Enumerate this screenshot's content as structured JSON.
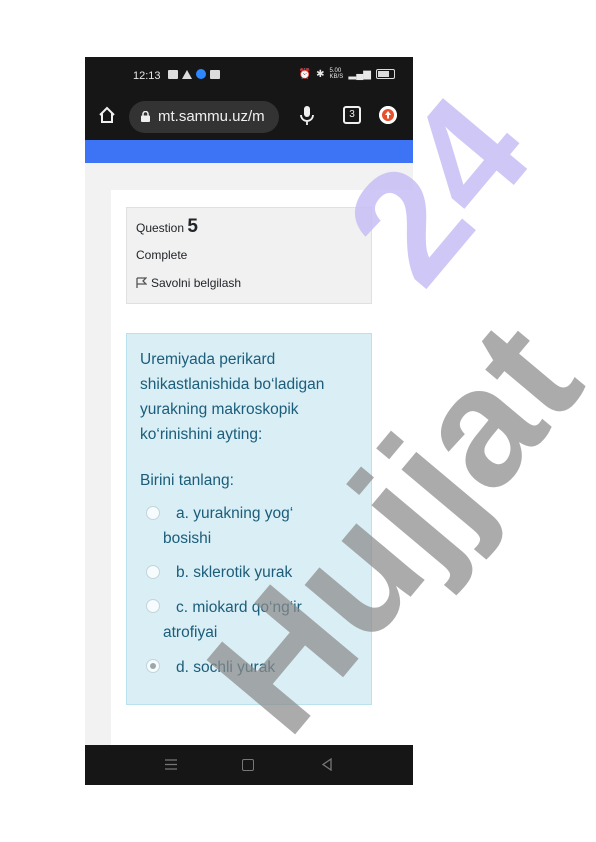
{
  "status_bar": {
    "time": "12:13",
    "net_speed": "5.00 KB/S"
  },
  "browser": {
    "url": "mt.sammu.uz/m",
    "tab_count": "3"
  },
  "question_info": {
    "label": "Question",
    "number": "5",
    "state": "Complete",
    "flag_label": "Savolni belgilash"
  },
  "question": {
    "text": "Uremiyada perikard shikastlanishida bo‘ladigan yurakning makroskopik ko‘rinishini ayting:",
    "choose_label": "Birini tanlang:",
    "options": [
      {
        "line1": "a. yurakning yog‘",
        "line2": "bosishi",
        "selected": false
      },
      {
        "line1": "b. sklerotik yurak",
        "line2": "",
        "selected": false
      },
      {
        "line1": "c. miokard qo‘ng‘ir",
        "line2": "atrofiyai",
        "selected": false
      },
      {
        "line1": "d. sochli yurak",
        "line2": "",
        "selected": true
      }
    ]
  },
  "watermark": {
    "brand": "Hujjat",
    "number": "24"
  },
  "colors": {
    "accent_blue": "#3d73f5",
    "question_bg": "#d9eef5",
    "question_text": "#1b5d7a",
    "watermark_grey": "#8a8a8a",
    "watermark_purple": "#c7bdf5"
  }
}
